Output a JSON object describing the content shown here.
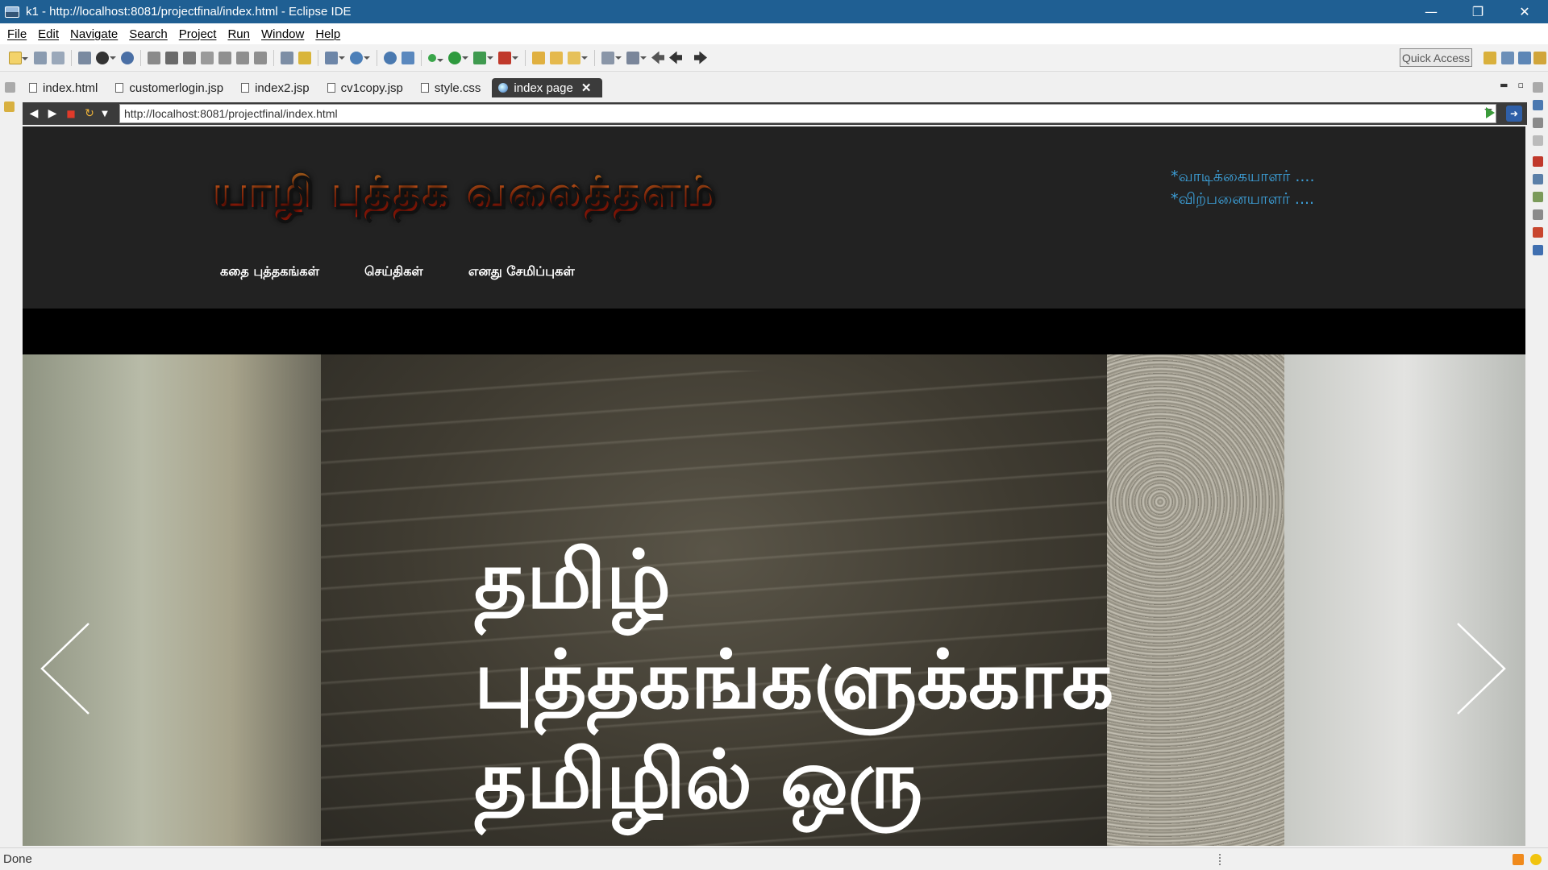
{
  "window": {
    "title": "k1 - http://localhost:8081/projectfinal/index.html - Eclipse IDE",
    "controls": {
      "minimize": "—",
      "restore": "❐",
      "close": "✕"
    }
  },
  "menu": [
    "File",
    "Edit",
    "Navigate",
    "Search",
    "Project",
    "Run",
    "Window",
    "Help"
  ],
  "toolbar": {
    "quick_access": "Quick Access"
  },
  "tabs": [
    {
      "label": "index.html",
      "active": false
    },
    {
      "label": "customerlogin.jsp",
      "active": false
    },
    {
      "label": "index2.jsp",
      "active": false
    },
    {
      "label": "cv1copy.jsp",
      "active": false
    },
    {
      "label": "style.css",
      "active": false
    },
    {
      "label": "index page",
      "active": true,
      "close": "✕"
    }
  ],
  "browser": {
    "url": "http://localhost:8081/projectfinal/index.html"
  },
  "site": {
    "logo_text": "யாழி புத்தக வலைத்தளம்",
    "links": [
      "*வாடிக்கையாளர் ....",
      "*விற்பனையாளர் ...."
    ],
    "nav": [
      "கதை புத்தகங்கள்",
      "செய்திகள்",
      "எனது சேமிப்புகள்"
    ],
    "hero_lines": [
      "தமிழ்",
      "புத்தகங்களுக்காக",
      "தமிழில் ஒரு"
    ]
  },
  "status": {
    "text": "Done"
  },
  "colors": {
    "titlebar": "#1f5f93",
    "site_background": "#222222",
    "logo_red": "#e8350c",
    "link_blue": "#3c9ed6"
  }
}
